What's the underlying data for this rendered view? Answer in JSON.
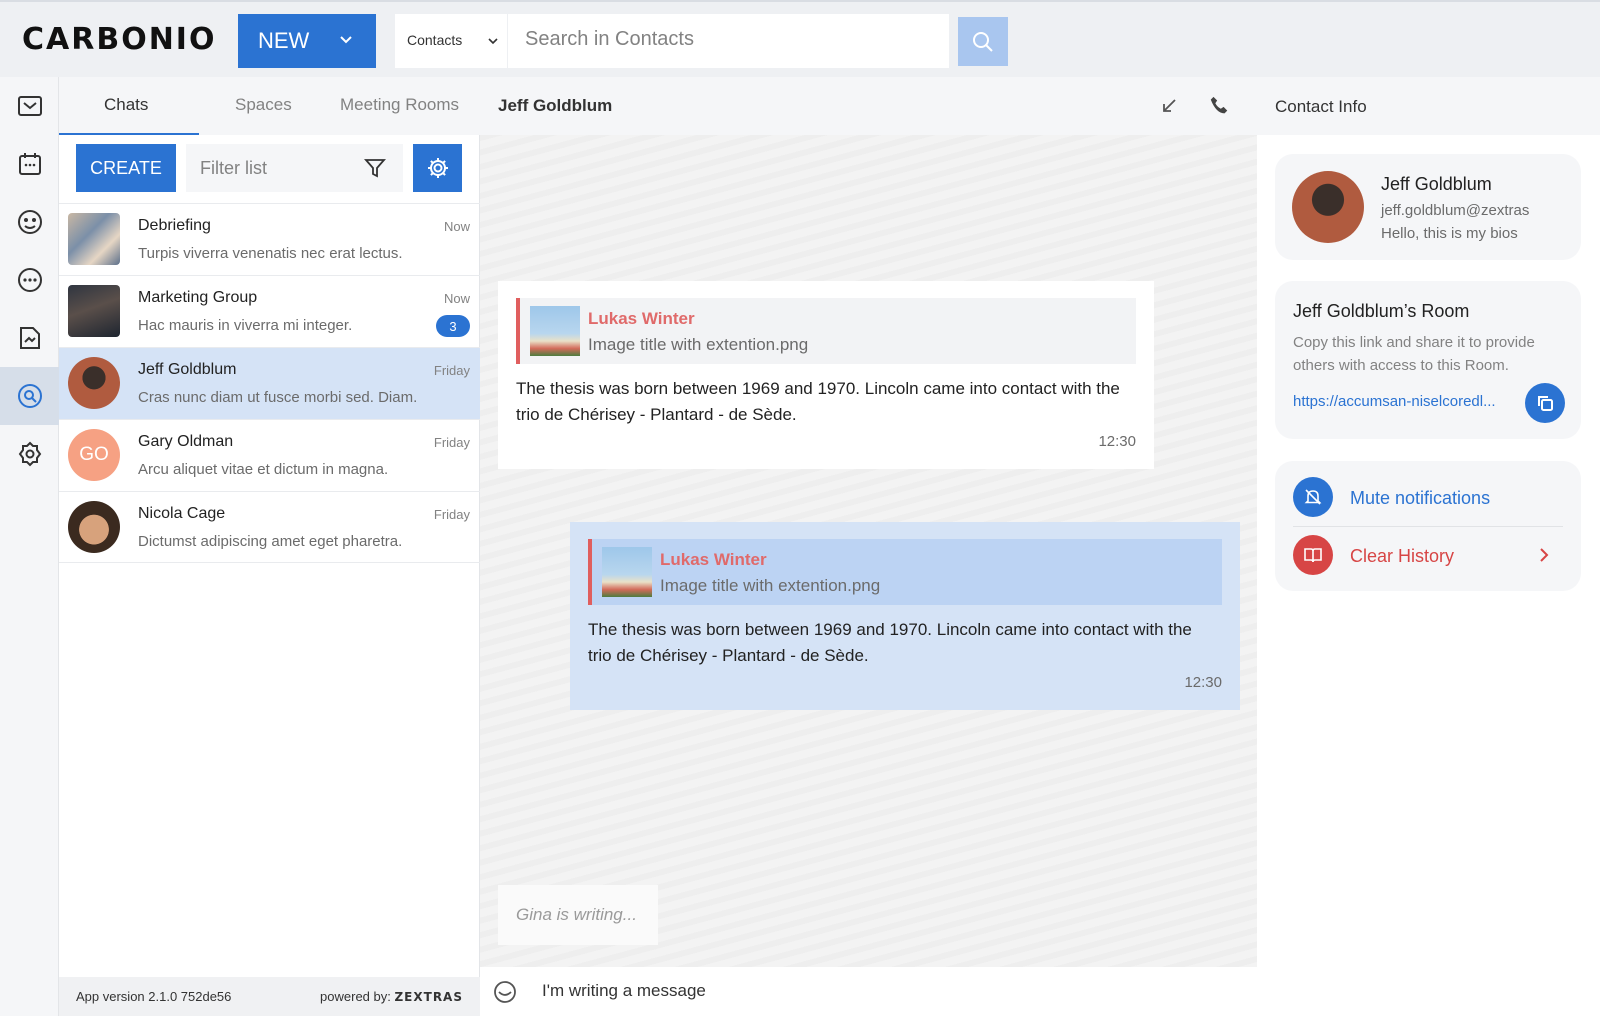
{
  "app": {
    "logo": "CARBONIO"
  },
  "header": {
    "new_label": "NEW",
    "search_module": "Contacts",
    "search_placeholder": "Search in Contacts"
  },
  "chatlist": {
    "tabs": [
      {
        "label": "Chats"
      },
      {
        "label": "Spaces"
      },
      {
        "label": "Meeting Rooms"
      }
    ],
    "create_label": "CREATE",
    "filter_placeholder": "Filter list",
    "rows": [
      {
        "name": "Debriefing",
        "time": "Now",
        "preview": "Turpis viverra venenatis nec erat lectus."
      },
      {
        "name": "Marketing Group",
        "time": "Now",
        "preview": "Hac mauris in viverra mi integer.",
        "badge": "3"
      },
      {
        "name": "Jeff Goldblum",
        "time": "Friday",
        "preview": "Cras nunc diam ut fusce morbi sed. Diam."
      },
      {
        "name": "Gary Oldman",
        "time": "Friday",
        "preview": "Arcu aliquet vitae et dictum in magna.",
        "initials": "GO"
      },
      {
        "name": "Nicola Cage",
        "time": "Friday",
        "preview": "Dictumst adipiscing amet eget pharetra."
      }
    ],
    "footer": {
      "version": "App version 2.1.0 752de56",
      "powered": "powered by:",
      "brand": "ZEXTRAS"
    }
  },
  "conversation": {
    "title": "Jeff Goldblum",
    "messages": [
      {
        "quote_name": "Lukas Winter",
        "quote_sub": "Image title with extention.png",
        "line1": "The thesis was born between 1969 and 1970. Lincoln came into contact with the",
        "line2": "trio de Chérisey - Plantard - de Sède.",
        "time": "12:30"
      },
      {
        "quote_name": "Lukas Winter",
        "quote_sub": "Image title with extention.png",
        "line1": "The thesis was born between 1969 and 1970. Lincoln came into contact with the",
        "line2": "trio de Chérisey - Plantard - de Sède.",
        "time": "12:30"
      }
    ],
    "typing": "Gina is writing...",
    "composer_value": "I'm writing a message"
  },
  "info": {
    "title": "Contact Info",
    "profile": {
      "name": "Jeff Goldblum",
      "email": "jeff.goldblum@zextras",
      "bio": "Hello, this is my bios"
    },
    "room": {
      "title": "Jeff Goldblum’s Room",
      "desc": "Copy this link and share it to provide others with access to this Room.",
      "link": "https://accumsan-niselcoredl..."
    },
    "actions": {
      "mute": "Mute notifications",
      "clear": "Clear History"
    }
  },
  "colors": {
    "accent": "#2b73d2",
    "danger": "#d74545",
    "selected": "#d5e3f6"
  }
}
